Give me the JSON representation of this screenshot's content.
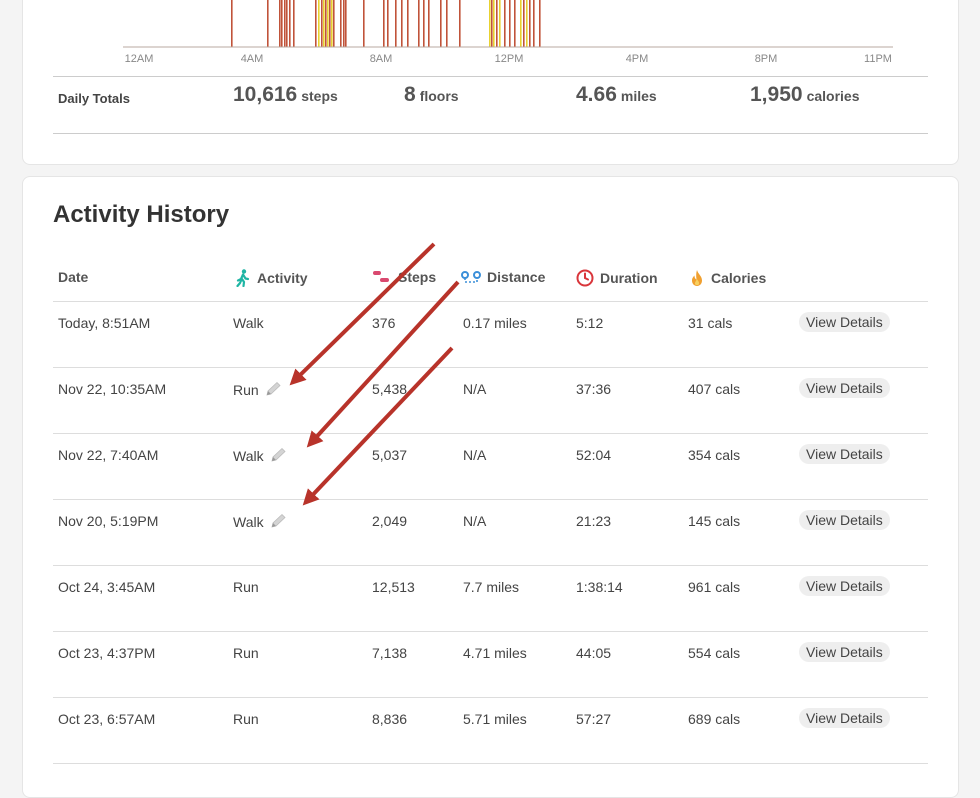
{
  "activity_chart": {
    "x_ticks": [
      "12AM",
      "4AM",
      "8AM",
      "12PM",
      "4PM",
      "8PM",
      "11PM"
    ]
  },
  "daily_totals": {
    "label": "Daily Totals",
    "steps": {
      "value": "10,616",
      "unit": "steps"
    },
    "floors": {
      "value": "8",
      "unit": "floors"
    },
    "miles": {
      "value": "4.66",
      "unit": "miles"
    },
    "calories": {
      "value": "1,950",
      "unit": "calories"
    }
  },
  "history": {
    "title": "Activity History",
    "columns": {
      "date": "Date",
      "activity": "Activity",
      "steps": "Steps",
      "distance": "Distance",
      "duration": "Duration",
      "calories": "Calories"
    },
    "icons": {
      "activity": "walking-person-icon",
      "steps": "footprints-icon",
      "distance": "route-icon",
      "duration": "clock-icon",
      "calories": "flame-icon",
      "edit": "pencil-icon"
    },
    "view_details_label": "View Details",
    "rows": [
      {
        "date": "Today, 8:51AM",
        "activity": "Walk",
        "editable": false,
        "steps": "376",
        "distance": "0.17 miles",
        "duration": "5:12",
        "calories": "31 cals"
      },
      {
        "date": "Nov 22, 10:35AM",
        "activity": "Run",
        "editable": true,
        "steps": "5,438",
        "distance": "N/A",
        "duration": "37:36",
        "calories": "407 cals"
      },
      {
        "date": "Nov 22, 7:40AM",
        "activity": "Walk",
        "editable": true,
        "steps": "5,037",
        "distance": "N/A",
        "duration": "52:04",
        "calories": "354 cals"
      },
      {
        "date": "Nov 20, 5:19PM",
        "activity": "Walk",
        "editable": true,
        "steps": "2,049",
        "distance": "N/A",
        "duration": "21:23",
        "calories": "145 cals"
      },
      {
        "date": "Oct 24, 3:45AM",
        "activity": "Run",
        "editable": false,
        "steps": "12,513",
        "distance": "7.7 miles",
        "duration": "1:38:14",
        "calories": "961 cals"
      },
      {
        "date": "Oct 23, 4:37PM",
        "activity": "Run",
        "editable": false,
        "steps": "7,138",
        "distance": "4.71 miles",
        "duration": "44:05",
        "calories": "554 cals"
      },
      {
        "date": "Oct 23, 6:57AM",
        "activity": "Run",
        "editable": false,
        "steps": "8,836",
        "distance": "5.71 miles",
        "duration": "57:27",
        "calories": "689 cals"
      }
    ]
  },
  "colors": {
    "bar_red": "#c0533a",
    "bar_yellow": "#e8d230",
    "annotation_arrow": "#b8332a",
    "activity_icon": "#1fb5a4",
    "steps_icon": "#d9496f",
    "distance_icon": "#3b8fd9",
    "duration_icon": "#d9363b",
    "calories_icon": "#f0a030"
  }
}
